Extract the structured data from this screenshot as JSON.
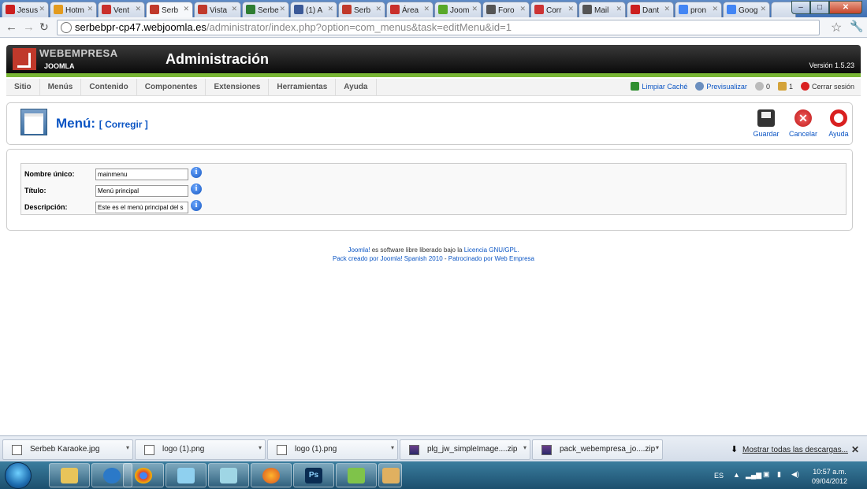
{
  "browser": {
    "tabs": [
      {
        "label": "Jesus",
        "color": "#cc1f1f"
      },
      {
        "label": "Hotm",
        "color": "#e39b1e"
      },
      {
        "label": "Vent",
        "color": "#c9302c"
      },
      {
        "label": "Serb",
        "color": "#c0392b",
        "active": true
      },
      {
        "label": "Vista",
        "color": "#c0392b"
      },
      {
        "label": "Serbe",
        "color": "#2e7d32"
      },
      {
        "label": "(1) A",
        "color": "#3b5998"
      },
      {
        "label": "Serb",
        "color": "#c0392b"
      },
      {
        "label": "Área",
        "color": "#c9302c"
      },
      {
        "label": "Joom",
        "color": "#58a829"
      },
      {
        "label": "Foro",
        "color": "#555555"
      },
      {
        "label": "Corr",
        "color": "#cc3333"
      },
      {
        "label": "Mail",
        "color": "#555555"
      },
      {
        "label": "Dant",
        "color": "#cc1f1f"
      },
      {
        "label": "pron",
        "color": "#4285f4"
      },
      {
        "label": "Goog",
        "color": "#4285f4"
      }
    ],
    "url_host": "serbebpr-cp47.webjoomla.es",
    "url_path": "/administrator/index.php?option=com_menus&task=editMenu&id=1",
    "icons": [
      "back-icon",
      "forward-icon",
      "reload-icon",
      "star-icon",
      "wrench-icon"
    ]
  },
  "joomla": {
    "brand": "WEBEMPRESA",
    "brand_sub": "JOOMLA",
    "title": "Administración",
    "version": "Versión 1.5.23",
    "menu": [
      "Sitio",
      "Menús",
      "Contenido",
      "Componentes",
      "Extensiones",
      "Herramientas",
      "Ayuda"
    ],
    "status": {
      "clear_cache": "Limpiar Caché",
      "preview": "Previsualizar",
      "messages": "0",
      "users": "1",
      "logout": "Cerrar sesión"
    },
    "page_title": "Menú:",
    "page_subtitle": "[ Corregir ]",
    "buttons": {
      "save": "Guardar",
      "cancel": "Cancelar",
      "help": "Ayuda"
    },
    "form": {
      "name_label": "Nombre único:",
      "name_value": "mainmenu",
      "title_label": "Título:",
      "title_value": "Menú principal",
      "desc_label": "Descripción:",
      "desc_value": "Este es el menú principal del s"
    },
    "footer": {
      "line1_link": "Joomla!",
      "line1_text": " es software libre liberado bajo la ",
      "line1_license": "Licencia GNU/GPL.",
      "line2_a": "Pack creado por Joomla! Spanish 2010",
      "line2_sep": " - ",
      "line2_b": "Patrocinado por Web Empresa"
    }
  },
  "downloads": {
    "items": [
      {
        "name": "Serbeb Karaoke.jpg",
        "type": "img"
      },
      {
        "name": "logo (1).png",
        "type": "img"
      },
      {
        "name": "logo (1).png",
        "type": "img"
      },
      {
        "name": "plg_jw_simpleImage....zip",
        "type": "zip"
      },
      {
        "name": "pack_webempresa_jo....zip",
        "type": "zip"
      }
    ],
    "show_all": "Mostrar todas las descargas..."
  },
  "taskbar": {
    "language": "ES",
    "time": "10:57 a.m.",
    "date": "09/04/2012"
  }
}
